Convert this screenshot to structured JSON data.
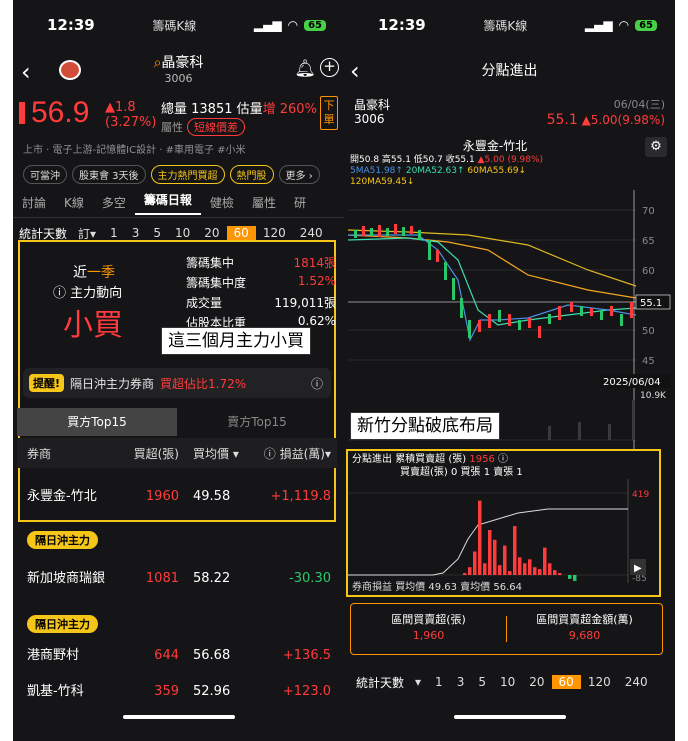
{
  "left": {
    "status": {
      "time": "12:39",
      "app": "籌碼K線",
      "battery": "65"
    },
    "nav": {
      "title": "晶豪科",
      "code": "3006"
    },
    "quote": {
      "price": "56.9",
      "change": "▲1.8",
      "change_pct": "(3.27%)",
      "volume_label": "總量 13851 估量",
      "volume_inc": "增 260%",
      "attr_label": "屬性",
      "attr_badge": "短線價差",
      "order_btn": "下單"
    },
    "industry": "上市 · 電子上游-記憶體IC設計 · #車用電子 #小米",
    "chips": [
      "可當沖",
      "股東會 3天後",
      "主力熱門買超",
      "熱門股",
      "更多 ›"
    ],
    "tabs": [
      "討論",
      "K線",
      "多空",
      "籌碼日報",
      "健檢",
      "屬性",
      "研"
    ],
    "days": {
      "label": "統計天數",
      "opt": "訂▾",
      "values": [
        "1",
        "3",
        "5",
        "10",
        "20",
        "60",
        "120",
        "240"
      ],
      "selected": "60"
    },
    "summary": {
      "period_prefix": "近",
      "period_val": "一季",
      "force_label": "主力動向",
      "main_state": "小買",
      "metrics": [
        {
          "k": "籌碼集中",
          "v": "1814張"
        },
        {
          "k": "籌碼集中度",
          "v": "1.52%"
        },
        {
          "k": "成交量",
          "v": "119,011張"
        },
        {
          "k": "佔股本比重",
          "v": "0.62%"
        }
      ]
    },
    "callout1": "這三個月主力小買",
    "alert": {
      "tag": "提醒!",
      "text": "隔日沖主力券商",
      "highlight": "買超佔比1.72%"
    },
    "top_tabs": [
      "買方Top15",
      "賣方Top15"
    ],
    "table_head": [
      "券商",
      "買超(張)",
      "買均價 ▾",
      "ⓘ 損益(萬)▾"
    ],
    "rows": [
      {
        "name": "永豐金-竹北",
        "buy": "1960",
        "avg": "49.58",
        "pl": "+1,119.8",
        "pl_color": "red"
      },
      {
        "name": "新加坡商瑞銀",
        "buy": "1081",
        "avg": "58.22",
        "pl": "-30.30",
        "pl_color": "green",
        "tag": "隔日沖主力"
      },
      {
        "name": "港商野村",
        "buy": "644",
        "avg": "56.68",
        "pl": "+136.5",
        "pl_color": "red",
        "tag": "隔日沖主力"
      },
      {
        "name": "凱基-竹科",
        "buy": "359",
        "avg": "52.96",
        "pl": "+123.0",
        "pl_color": "red"
      }
    ]
  },
  "right": {
    "status": {
      "time": "12:39",
      "app": "籌碼K線",
      "battery": "65"
    },
    "nav_title": "分點進出",
    "info": {
      "name": "晶豪科",
      "code": "3006",
      "date": "06/04(三)",
      "price": "55.1",
      "change": "▲5.00(9.98%)"
    },
    "broker_title": "永豐金-竹北",
    "ohlc_line": "開50.8 高55.1 低50.7 收55.1",
    "ohlc_chg": "▲5.00 (9.98%)",
    "ma_line": [
      "5MA51.98↑",
      "20MA52.63↑",
      "60MA55.69↓"
    ],
    "ma120": "120MA59.45↓",
    "price_axis": [
      "70",
      "65",
      "60",
      "55.1",
      "50",
      "45"
    ],
    "cursor_date": "2025/06/04",
    "vol_label": "10.9K",
    "callout2": "新竹分點破底布局",
    "lower": {
      "title": "分點進出",
      "cum_label": "累積買賣超 (張)",
      "cum_val": "1956",
      "line2": "買賣超(張) 0 買張 1 賣張 1",
      "axis_top": "419",
      "axis_bottom": "-85",
      "footer_label": "券商損益",
      "footer_vals": "買均價 49.63  賣均價 56.64"
    },
    "summary": [
      {
        "k": "區間買賣超(張)",
        "v": "1,960"
      },
      {
        "k": "區間買賣超金額(萬)",
        "v": "9,680"
      }
    ],
    "days": {
      "label": "統計天數",
      "values": [
        "1",
        "3",
        "5",
        "10",
        "20",
        "60",
        "120",
        "240"
      ],
      "selected": "60"
    },
    "chart_data": {
      "type": "bar",
      "title": "永豐金-竹北",
      "ylabel": "",
      "ylim": [
        -85,
        419
      ],
      "values": [
        0,
        0,
        0,
        0,
        0,
        0,
        0,
        10,
        40,
        120,
        380,
        60,
        230,
        180,
        50,
        150,
        20,
        250,
        90,
        60,
        80,
        40,
        30,
        140,
        60,
        25,
        10,
        0,
        -20,
        -30,
        0,
        0,
        0,
        0,
        0,
        0,
        0,
        0,
        0,
        0
      ]
    }
  }
}
